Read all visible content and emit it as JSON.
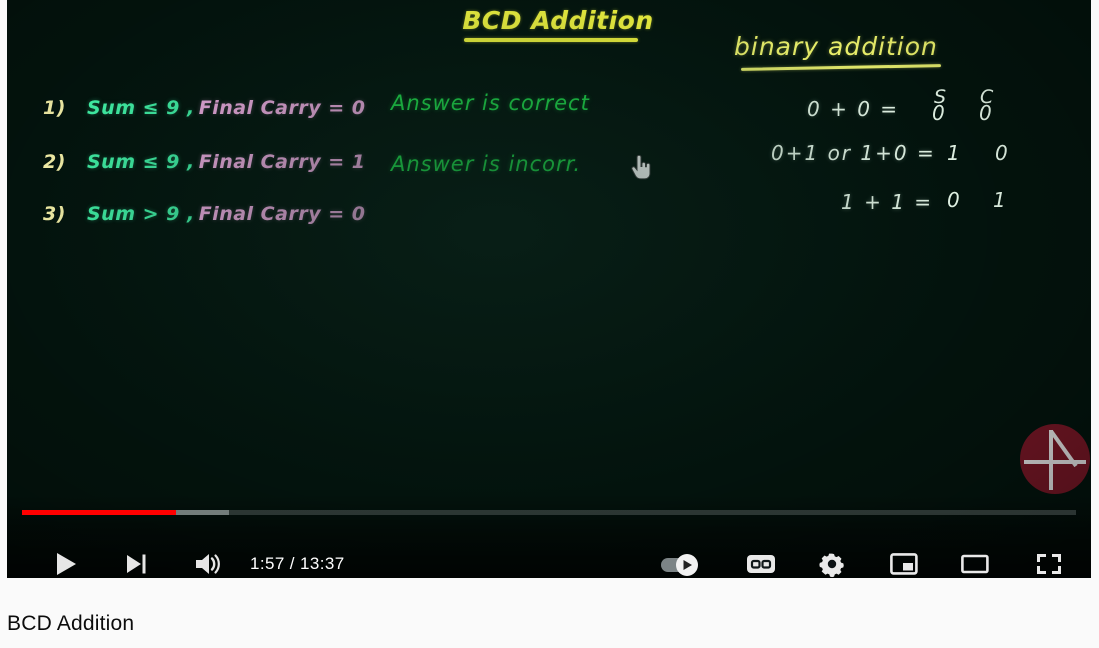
{
  "video": {
    "board_title": "BCD Addition",
    "rules": [
      {
        "index": "1)",
        "condition": "Sum  ≤ 9 ,",
        "carry": "Final Carry = 0"
      },
      {
        "index": "2)",
        "condition": "Sum  ≤ 9 ,",
        "carry": "Final Carry = 1"
      },
      {
        "index": "3)",
        "condition": "Sum  >  9 ,",
        "carry": "Final Carry = 0"
      }
    ],
    "verdicts": [
      "Answer is correct",
      "Answer is incorr."
    ],
    "binary_section": {
      "heading": "binary addition",
      "col_headers": {
        "sum": "S",
        "carry": "C"
      },
      "lines": [
        {
          "expr": "0 + 0  =",
          "sum": "0",
          "carry": "0"
        },
        {
          "expr": "0+1  or  1+0  =",
          "sum": "1",
          "carry": "0"
        },
        {
          "expr": "1 + 1    =",
          "sum": "0",
          "carry": "1"
        }
      ]
    },
    "cursor_icon": "hand-pointer-icon",
    "watermark_icon": "channel-watermark-icon"
  },
  "player": {
    "progress": {
      "played_percent": 14.6,
      "buffered_percent": 19.6
    },
    "time": "1:57 / 13:37",
    "controls": {
      "play": "play-icon",
      "next": "next-track-icon",
      "volume": "volume-icon",
      "autoplay": "autoplay-toggle",
      "autoplay_state": "on",
      "cc": "CC",
      "settings": "gear-icon",
      "miniplayer": "miniplayer-icon",
      "theater": "theater-mode-icon",
      "fullscreen": "fullscreen-icon"
    },
    "colors": {
      "progress_played": "#ff0000",
      "board_background": "#03130d",
      "title_yellow": "#f2f53f",
      "condition_green": "#3ee8a0",
      "carry_pink": "#e7a6da",
      "verdict_green": "#1fd84a",
      "watermark_red": "#711624"
    }
  },
  "page": {
    "video_title": "BCD Addition"
  }
}
